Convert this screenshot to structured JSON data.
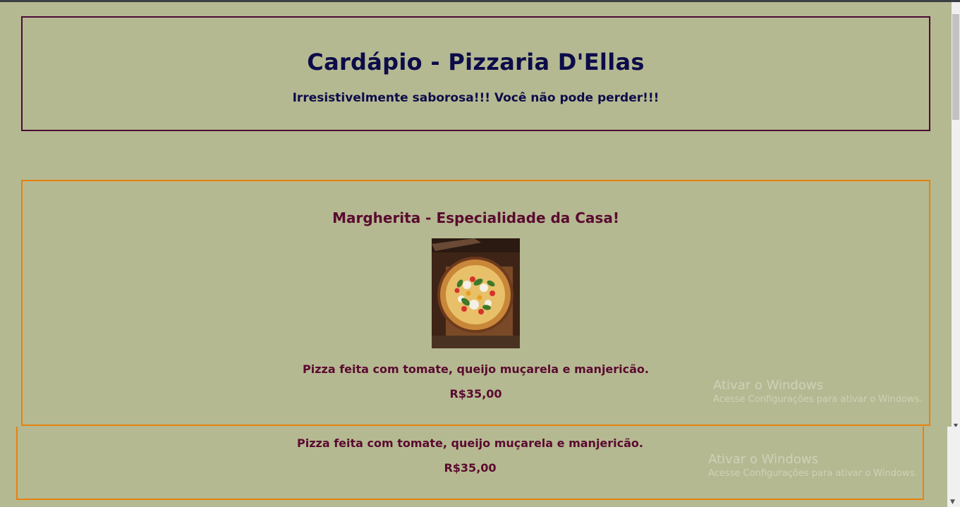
{
  "header": {
    "title": "Cardápio - Pizzaria D'Ellas",
    "subtitle": "Irresistivelmente saborosa!!! Você não pode perder!!!"
  },
  "menu_item": {
    "title": "Margherita - Especialidade da Casa!",
    "description": "Pizza feita com tomate, queijo muçarela e manjericão.",
    "price": "R$35,00"
  },
  "lower_view": {
    "description": "Pizza feita com tomate, queijo muçarela e manjericão.",
    "price": "R$35,00"
  },
  "watermark": {
    "title": "Ativar o Windows",
    "subtitle": "Acesse Configurações para ativar o Windows."
  },
  "icons": {
    "scroll_down": "chevron-down-icon"
  },
  "colors": {
    "background": "#b5b991",
    "header_border": "#4a0b37",
    "card_border": "#e5820e",
    "title_color": "#0c0c4a",
    "item_text": "#5a0a30"
  }
}
